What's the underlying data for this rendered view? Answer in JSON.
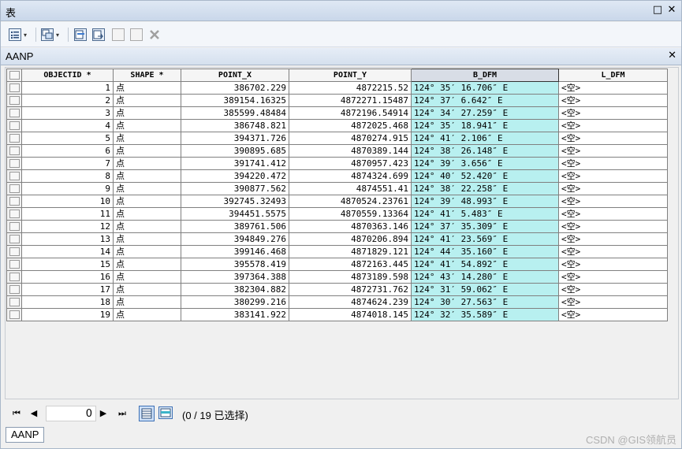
{
  "window": {
    "title": "表",
    "maximize_label": "□",
    "close_label": "✕"
  },
  "toolbar": {
    "icons": [
      "table-options-icon",
      "related-tables-icon",
      "select-by-attributes-icon",
      "switch-selection-icon",
      "clear-selection-icon",
      "zoom-to-selected-icon",
      "delete-selected-icon"
    ],
    "caret": "▾"
  },
  "tab": {
    "title": "AANP",
    "close_label": "✕"
  },
  "table": {
    "columns": [
      "OBJECTID *",
      "SHAPE *",
      "POINT_X",
      "POINT_Y",
      "B_DFM",
      "L_DFM"
    ],
    "selected_column": "B_DFM",
    "highlight_color": "#b8f0f0",
    "rows": [
      [
        "1",
        "点",
        "386702.229",
        "4872215.52",
        "124°  35′  16.706″ E",
        "<空>"
      ],
      [
        "2",
        "点",
        "389154.16325",
        "4872271.15487",
        "124°  37′  6.642″ E",
        "<空>"
      ],
      [
        "3",
        "点",
        "385599.48484",
        "4872196.54914",
        "124°  34′  27.259″ E",
        "<空>"
      ],
      [
        "4",
        "点",
        "386748.821",
        "4872025.468",
        "124°  35′  18.941″ E",
        "<空>"
      ],
      [
        "5",
        "点",
        "394371.726",
        "4870274.915",
        "124°  41′  2.106″ E",
        "<空>"
      ],
      [
        "6",
        "点",
        "390895.685",
        "4870389.144",
        "124°  38′  26.148″ E",
        "<空>"
      ],
      [
        "7",
        "点",
        "391741.412",
        "4870957.423",
        "124°  39′  3.656″ E",
        "<空>"
      ],
      [
        "8",
        "点",
        "394220.472",
        "4874324.699",
        "124°  40′  52.420″ E",
        "<空>"
      ],
      [
        "9",
        "点",
        "390877.562",
        "4874551.41",
        "124°  38′  22.258″ E",
        "<空>"
      ],
      [
        "10",
        "点",
        "392745.32493",
        "4870524.23761",
        "124°  39′  48.993″ E",
        "<空>"
      ],
      [
        "11",
        "点",
        "394451.5575",
        "4870559.13364",
        "124°  41′  5.483″ E",
        "<空>"
      ],
      [
        "12",
        "点",
        "389761.506",
        "4870363.146",
        "124°  37′  35.309″ E",
        "<空>"
      ],
      [
        "13",
        "点",
        "394849.276",
        "4870206.894",
        "124°  41′  23.569″ E",
        "<空>"
      ],
      [
        "14",
        "点",
        "399146.468",
        "4871829.121",
        "124°  44′  35.160″ E",
        "<空>"
      ],
      [
        "15",
        "点",
        "395578.419",
        "4872163.445",
        "124°  41′  54.892″ E",
        "<空>"
      ],
      [
        "16",
        "点",
        "397364.388",
        "4873189.598",
        "124°  43′  14.280″ E",
        "<空>"
      ],
      [
        "17",
        "点",
        "382304.882",
        "4872731.762",
        "124°  31′  59.062″ E",
        "<空>"
      ],
      [
        "18",
        "点",
        "380299.216",
        "4874624.239",
        "124°  30′  27.563″ E",
        "<空>"
      ],
      [
        "19",
        "点",
        "383141.922",
        "4874018.145",
        "124°  32′  35.589″ E",
        "<空>"
      ]
    ]
  },
  "nav": {
    "first": "⏮",
    "prev": "◀",
    "next": "▶",
    "last": "⏭",
    "current_record": "0",
    "status": "(0 / 19 已选择)"
  },
  "bottom_tab": {
    "label": "AANP"
  },
  "watermark": "CSDN @GIS领航员"
}
